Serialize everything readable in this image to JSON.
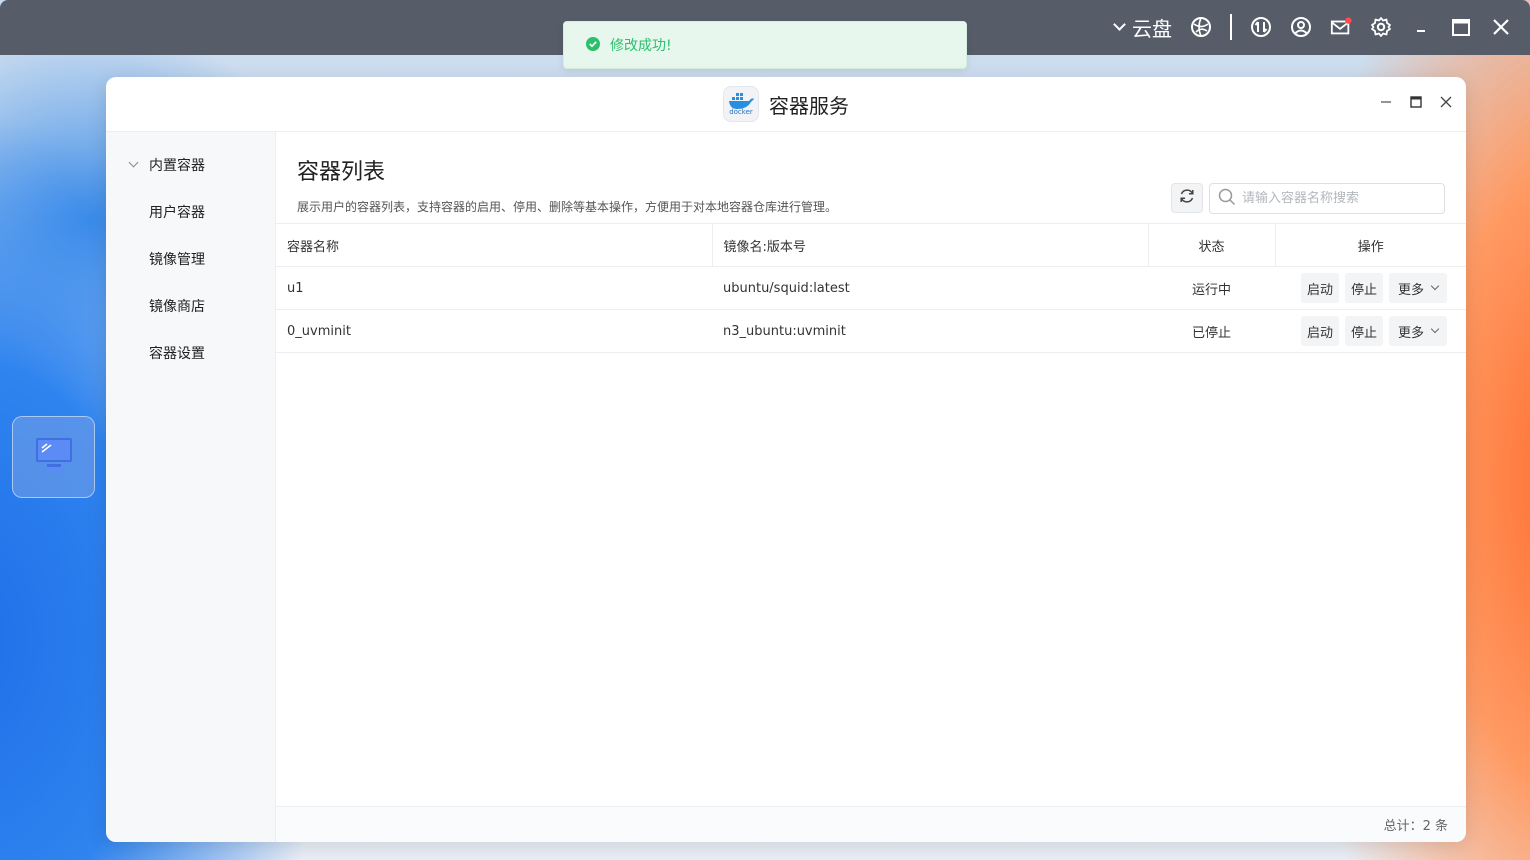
{
  "topbar": {
    "cloud_label": "云盘",
    "icons": [
      "chevron-down-icon",
      "globe-icon",
      "transfer-icon",
      "user-icon",
      "mail-icon",
      "gear-icon",
      "minimize-icon",
      "maximize-icon",
      "close-icon"
    ]
  },
  "toast": {
    "message": "修改成功!"
  },
  "window": {
    "title": "容器服务",
    "logo_text": "docker"
  },
  "sidebar": {
    "items": [
      {
        "label": "内置容器"
      },
      {
        "label": "用户容器"
      },
      {
        "label": "镜像管理"
      },
      {
        "label": "镜像商店"
      },
      {
        "label": "容器设置"
      }
    ]
  },
  "main": {
    "title": "容器列表",
    "description": "展示用户的容器列表，支持容器的启用、停用、删除等基本操作，方便用于对本地容器仓库进行管理。",
    "search_placeholder": "请输入容器名称搜索",
    "columns": [
      "容器名称",
      "镜像名:版本号",
      "状态",
      "操作"
    ],
    "rows": [
      {
        "name": "u1",
        "image": "ubuntu/squid:latest",
        "status": "运行中"
      },
      {
        "name": "0_uvminit",
        "image": "n3_ubuntu:uvminit",
        "status": "已停止"
      }
    ],
    "actions": {
      "start": "启动",
      "stop": "停止",
      "more": "更多"
    },
    "footer": "总计：2 条"
  },
  "colors": {
    "toast_green": "#2cc06d",
    "topbar": "#565d68",
    "mail_badge": "#ff4d4f"
  }
}
